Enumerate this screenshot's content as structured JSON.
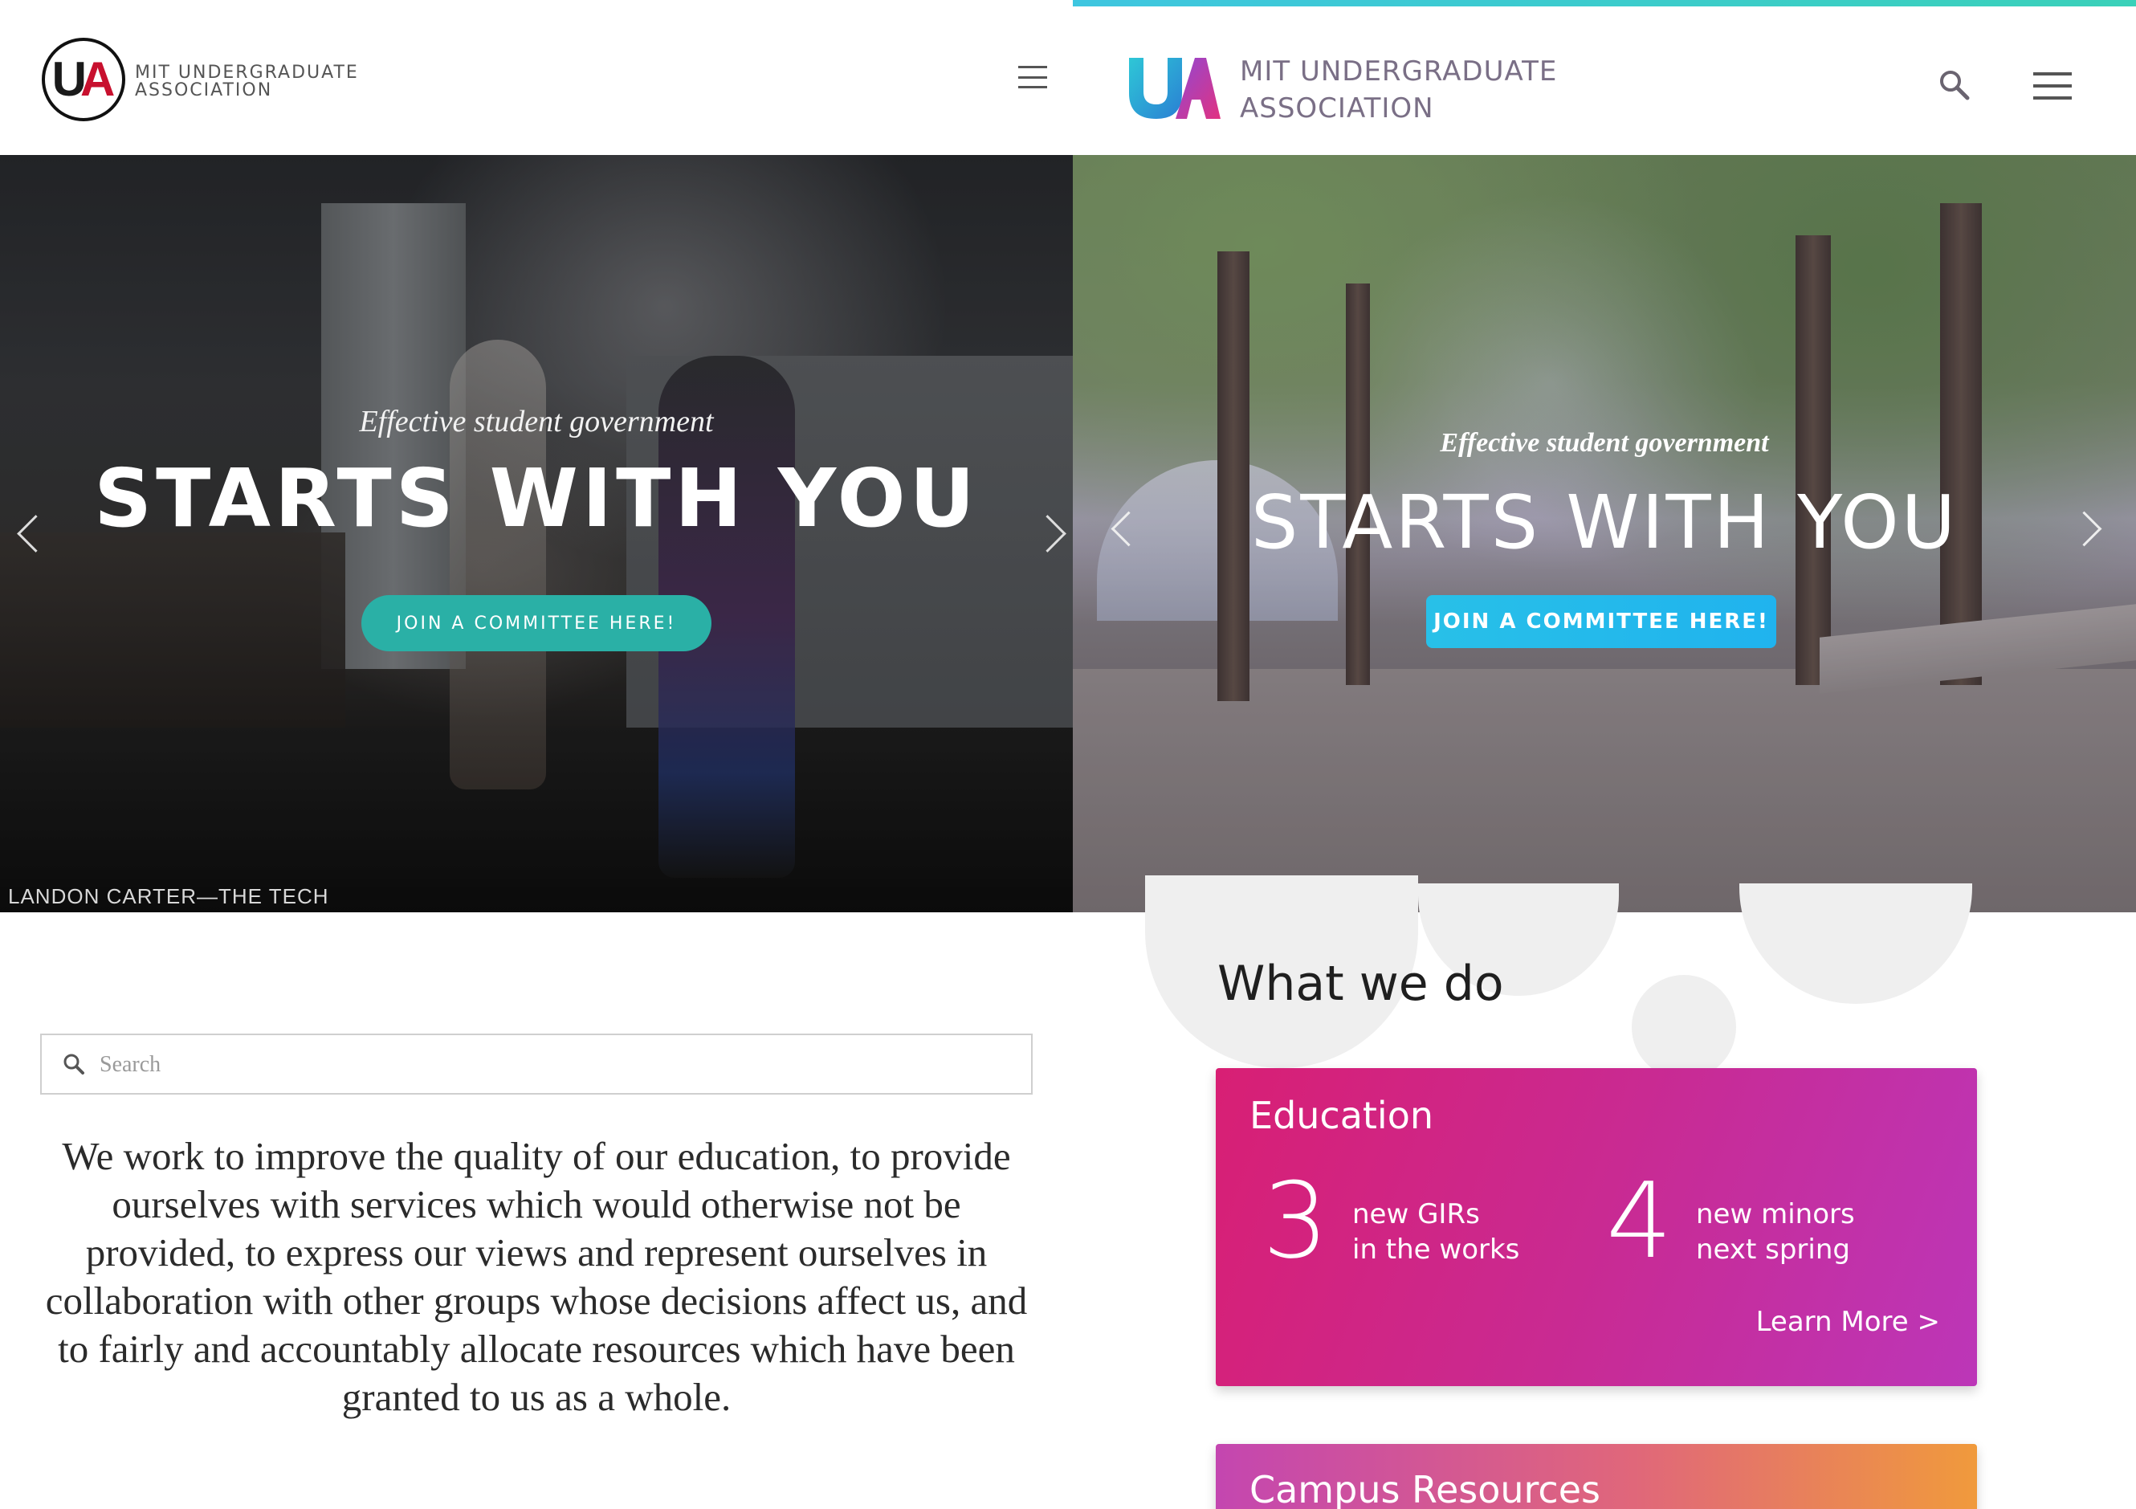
{
  "left": {
    "header": {
      "logo_text_line1": "MIT UNDERGRADUATE",
      "logo_text_line2": "ASSOCIATION",
      "logo_monogram_u": "U",
      "logo_monogram_a": "A"
    },
    "hero": {
      "tagline": "Effective student government",
      "headline": "STARTS WITH YOU",
      "cta_label": "JOIN A COMMITTEE HERE!",
      "photo_credit": "LANDON CARTER—THE TECH"
    },
    "search": {
      "placeholder": "Search"
    },
    "mission": "We work to improve the quality of our education, to provide ourselves with services which would otherwise not be provided, to express our views and represent ourselves in collaboration with other groups whose decisions affect us, and to fairly and accountably allocate resources which have been granted to us as a whole."
  },
  "right": {
    "header": {
      "logo_text_line1": "MIT UNDERGRADUATE",
      "logo_text_line2": "ASSOCIATION"
    },
    "hero": {
      "tagline": "Effective student government",
      "headline": "STARTS WITH YOU",
      "cta_label": "JOIN A COMMITTEE HERE!"
    },
    "section_title": "What we do",
    "cards": {
      "education": {
        "title": "Education",
        "stat1_num": "3",
        "stat1_label": "new GIRs\nin the works",
        "stat2_num": "4",
        "stat2_label": "new minors\nnext spring",
        "link": "Learn More >"
      },
      "campus": {
        "title": "Campus Resources"
      }
    }
  },
  "colors": {
    "old_cta": "#2ab0a6",
    "new_cta": "#20b3ee",
    "accent_bar": "#3ec6e0",
    "education_card": "#d81f74",
    "campus_card_end": "#f09a3c",
    "brand_text": "#7a6f86"
  },
  "icons": [
    "hamburger-menu-icon",
    "search-icon",
    "chevron-left-icon",
    "chevron-right-icon"
  ]
}
